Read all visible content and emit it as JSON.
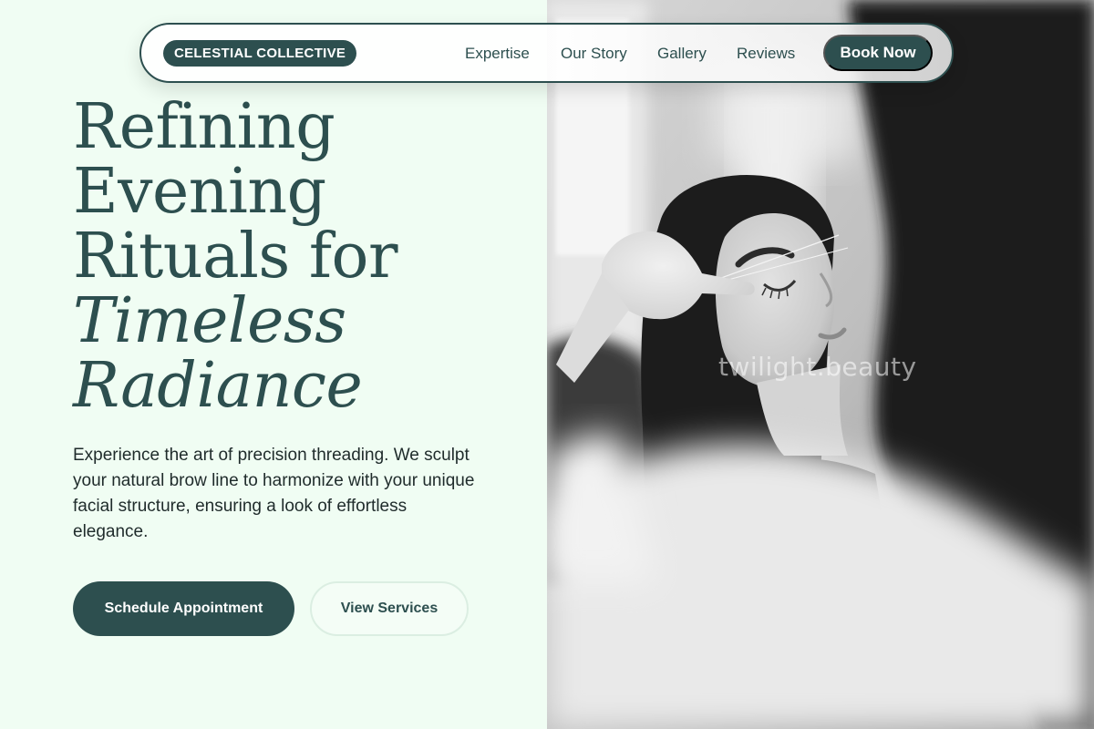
{
  "nav": {
    "brand": "CELESTIAL COLLECTIVE",
    "links": [
      "Expertise",
      "Our Story",
      "Gallery",
      "Reviews"
    ],
    "cta": "Book Now"
  },
  "hero": {
    "headline": {
      "line1": "Refining",
      "line2": "Evening",
      "line3": "Rituals for",
      "line4_italic": "Timeless",
      "line5_italic": "Radiance"
    },
    "description": "Experience the art of precision threading. We sculpt your natural brow line to harmonize with your unique facial structure, ensuring a look of effortless elegance.",
    "primary_button": "Schedule Appointment",
    "secondary_button": "View Services"
  },
  "photo": {
    "watermark": "twilight.beauty"
  },
  "colors": {
    "accent": "#2d4f4f",
    "background": "#f0fdf3"
  }
}
